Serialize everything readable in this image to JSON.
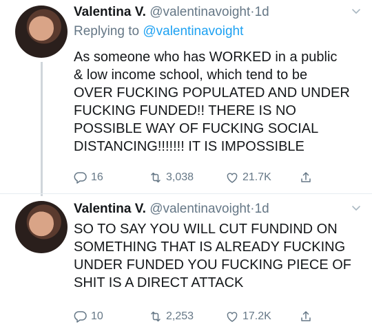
{
  "tweets": [
    {
      "name": "Valentina V.",
      "handle": "@valentinavoight",
      "dot": "·",
      "time": "1d",
      "replying_label": "Replying to",
      "replying_handle": "@valentinavoight",
      "text": "As someone who has WORKED in a public\n& low income school, which tend to be\nOVER FUCKING POPULATED AND UNDER\nFUCKING FUNDED!! THERE IS NO\nPOSSIBLE WAY OF FUCKING SOCIAL\nDISTANCING!!!!!!! IT IS IMPOSSIBLE",
      "replies": "16",
      "retweets": "3,038",
      "likes": "21.7K"
    },
    {
      "name": "Valentina V.",
      "handle": "@valentinavoight",
      "dot": "·",
      "time": "1d",
      "text": "SO TO SAY YOU WILL CUT FUNDIND ON\nSOMETHING THAT IS ALREADY FUCKING\nUNDER FUNDED YOU FUCKING PIECE OF\nSHIT IS A DIRECT ATTACK",
      "replies": "10",
      "retweets": "2,253",
      "likes": "17.2K"
    }
  ],
  "colors": {
    "text": "#14171a",
    "secondary": "#657786",
    "link": "#1da1f2",
    "thread_line": "#d0d6db"
  },
  "icons": [
    "chevron-down-icon",
    "reply-icon",
    "retweet-icon",
    "like-icon",
    "share-icon"
  ]
}
